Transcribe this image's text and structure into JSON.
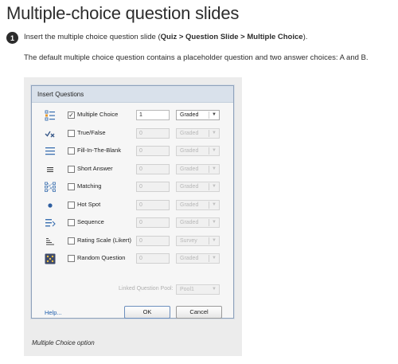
{
  "page": {
    "title": "Multiple-choice question slides",
    "step_number": "1",
    "step_text_pre": "Insert the multiple choice question slide (",
    "step_path": "Quiz > Question Slide > Multiple Choice",
    "step_text_post": ").",
    "step_description": "The default multiple choice question contains a placeholder question and two answer choices: A and B.",
    "caption": "Multiple Choice option"
  },
  "dialog": {
    "title": "Insert Questions",
    "rows": [
      {
        "icon": "multiple-choice-icon",
        "label": "Multiple Choice",
        "checked": true,
        "count": "1",
        "mode": "Graded",
        "enabled": true
      },
      {
        "icon": "true-false-icon",
        "label": "True/False",
        "checked": false,
        "count": "0",
        "mode": "Graded",
        "enabled": false
      },
      {
        "icon": "fill-in-the-blank-icon",
        "label": "Fill-In-The-Blank",
        "checked": false,
        "count": "0",
        "mode": "Graded",
        "enabled": false
      },
      {
        "icon": "short-answer-icon",
        "label": "Short Answer",
        "checked": false,
        "count": "0",
        "mode": "Graded",
        "enabled": false
      },
      {
        "icon": "matching-icon",
        "label": "Matching",
        "checked": false,
        "count": "0",
        "mode": "Graded",
        "enabled": false
      },
      {
        "icon": "hot-spot-icon",
        "label": "Hot Spot",
        "checked": false,
        "count": "0",
        "mode": "Graded",
        "enabled": false
      },
      {
        "icon": "sequence-icon",
        "label": "Sequence",
        "checked": false,
        "count": "0",
        "mode": "Graded",
        "enabled": false
      },
      {
        "icon": "rating-scale-icon",
        "label": "Rating Scale (Likert)",
        "checked": false,
        "count": "0",
        "mode": "Survey",
        "enabled": false
      },
      {
        "icon": "random-question-icon",
        "label": "Random Question",
        "checked": false,
        "count": "0",
        "mode": "Graded",
        "enabled": false
      }
    ],
    "pool_label": "Linked Question Pool:",
    "pool_value": "Pool1",
    "help_label": "Help...",
    "ok_label": "OK",
    "cancel_label": "Cancel"
  },
  "colors": {
    "accent": "#3a6fb0",
    "link": "#1f5fad",
    "titlebar": "#d9e1eb"
  }
}
